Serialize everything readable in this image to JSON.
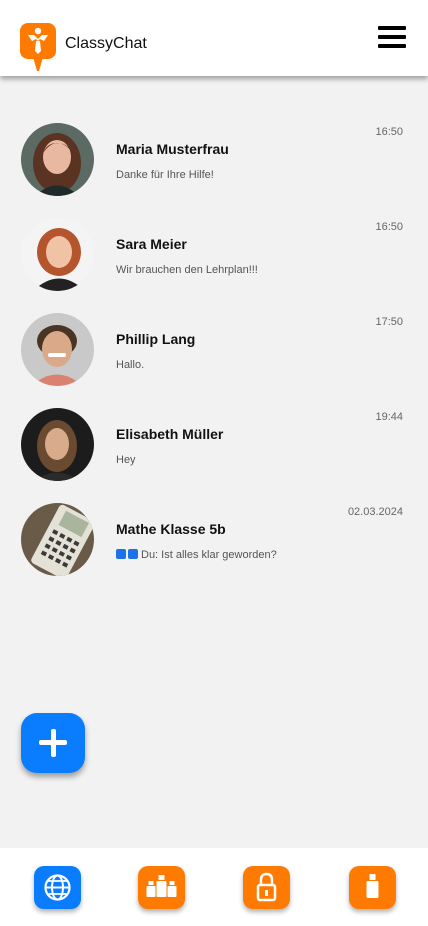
{
  "app": {
    "title": "ClassyChat",
    "logo_icon": "tie-person-logo-icon",
    "brand_color": "#ff7a00",
    "accent_color": "#0a7dff"
  },
  "header": {
    "menu_icon": "hamburger-menu-icon"
  },
  "chats": [
    {
      "name": "Maria Musterfrau",
      "time": "16:50",
      "preview": "Danke für Ihre Hilfe!",
      "read": false
    },
    {
      "name": "Sara Meier",
      "time": "16:50",
      "preview": "Wir brauchen den Lehrplan!!!",
      "read": false
    },
    {
      "name": "Phillip Lang",
      "time": "17:50",
      "preview": "Hallo.",
      "read": false
    },
    {
      "name": "Elisabeth Müller",
      "time": "19:44",
      "preview": "Hey",
      "read": false
    },
    {
      "name": "Mathe Klasse 5b",
      "time": "02.03.2024",
      "preview": "Du: Ist alles klar geworden?",
      "read": true
    }
  ],
  "fab": {
    "icon": "plus-icon"
  },
  "bottom_nav": [
    {
      "icon": "globe-icon",
      "active": true
    },
    {
      "icon": "group-icon",
      "active": false
    },
    {
      "icon": "lock-icon",
      "active": false
    },
    {
      "icon": "person-icon",
      "active": false
    }
  ]
}
